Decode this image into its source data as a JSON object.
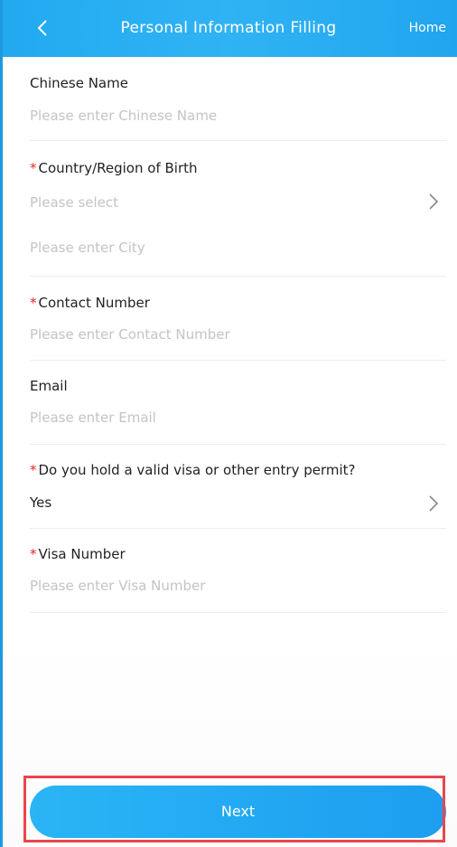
{
  "header": {
    "back_icon": "chevron-left-icon",
    "title": "Personal Information Filling",
    "home_label": "Home"
  },
  "form": {
    "chinese_name": {
      "label": "Chinese Name",
      "required": false,
      "placeholder": "Please enter Chinese Name"
    },
    "birth_country": {
      "required_mark": "*",
      "label": "Country/Region of Birth",
      "placeholder": "Please select",
      "icon": "chevron-right-icon"
    },
    "city": {
      "placeholder": "Please enter City"
    },
    "contact_number": {
      "required_mark": "*",
      "label": "Contact Number",
      "placeholder": "Please enter Contact Number"
    },
    "email": {
      "label": "Email",
      "required": false,
      "placeholder": "Please enter Email"
    },
    "visa_holder": {
      "required_mark": "*",
      "label": "Do you hold a valid visa or other entry permit?",
      "value": "Yes",
      "icon": "chevron-right-icon"
    },
    "visa_number": {
      "required_mark": "*",
      "label": "Visa Number",
      "placeholder": "Please enter Visa Number"
    }
  },
  "footer": {
    "next_label": "Next"
  },
  "colors": {
    "header_blue": "#21a9f0",
    "required_red": "#e8281e",
    "placeholder_gray": "#c4c4c4",
    "highlight_red": "#e8474c"
  }
}
